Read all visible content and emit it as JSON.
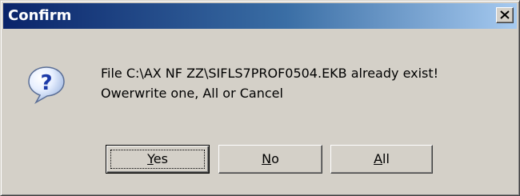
{
  "dialog": {
    "title": "Confirm",
    "icon": "question-icon",
    "message_line1": "File C:\\AX NF ZZ\\SIFLS7PROF0504.EKB already exist!",
    "message_line2": "Owerwrite one, All or Cancel",
    "buttons": {
      "yes": {
        "mnemonic": "Y",
        "rest": "es"
      },
      "no": {
        "mnemonic": "N",
        "rest": "o"
      },
      "all": {
        "mnemonic": "A",
        "rest": "ll"
      }
    }
  },
  "colors": {
    "titlebar_start": "#0a246a",
    "titlebar_end": "#a6caf0",
    "face": "#d4d0c8"
  }
}
